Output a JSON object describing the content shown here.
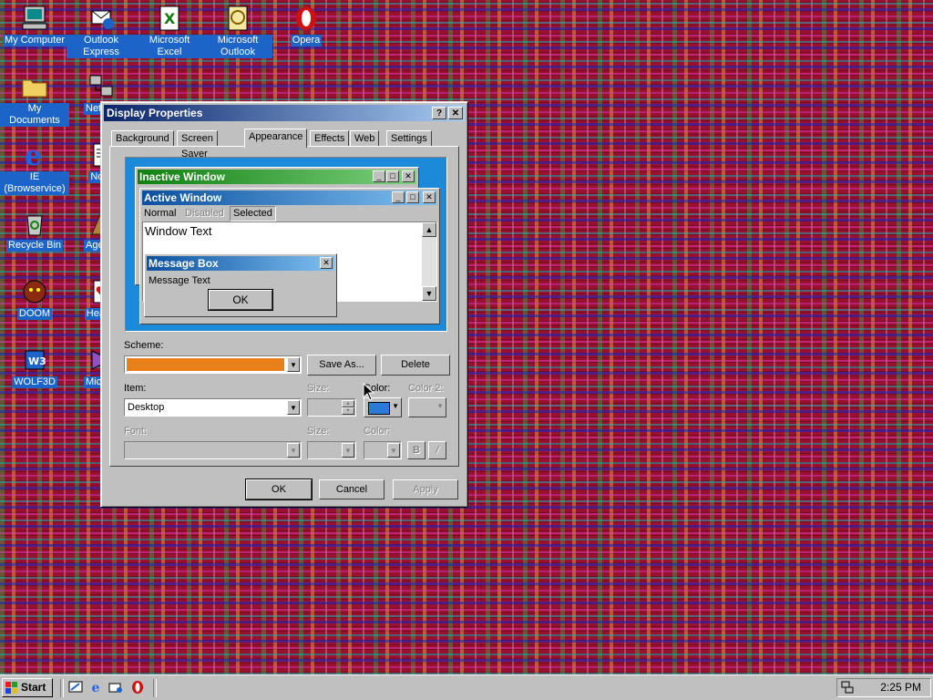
{
  "desktop": {
    "icons": [
      {
        "label": "My Computer",
        "icon": "my-computer-icon"
      },
      {
        "label": "Outlook Express",
        "icon": "outlook-express-icon"
      },
      {
        "label": "Microsoft Excel",
        "icon": "excel-icon"
      },
      {
        "label": "Microsoft Outlook",
        "icon": "outlook-icon"
      },
      {
        "label": "Opera",
        "icon": "opera-icon"
      },
      {
        "label": "My Documents",
        "icon": "folder-icon"
      },
      {
        "label": "Netw Neigh",
        "icon": "network-icon"
      },
      {
        "label": "IE (Browservice)",
        "icon": "ie-icon"
      },
      {
        "label": "Note",
        "icon": "notepad-icon"
      },
      {
        "label": "Recycle Bin",
        "icon": "recycle-bin-icon"
      },
      {
        "label": "Age Emp",
        "icon": "age-of-empires-icon"
      },
      {
        "label": "DOOM",
        "icon": "doom-icon"
      },
      {
        "label": "Hearts",
        "icon": "hearts-icon"
      },
      {
        "label": "WOLF3D",
        "icon": "wolf3d-icon"
      },
      {
        "label": "Micr Visual",
        "icon": "visual-studio-icon"
      }
    ]
  },
  "dialog": {
    "title": "Display Properties",
    "help_btn": "?",
    "close_btn": "✕",
    "tabs": [
      "Background",
      "Screen Saver",
      "Appearance",
      "Effects",
      "Web",
      "Settings"
    ],
    "selected_tab": "Appearance",
    "preview": {
      "inactive_title": "Inactive Window",
      "active_title": "Active Window",
      "menu": {
        "normal": "Normal",
        "disabled": "Disabled",
        "selected": "Selected"
      },
      "window_text": "Window Text",
      "msgbox_title": "Message Box",
      "msgbox_text": "Message Text",
      "ok": "OK"
    },
    "scheme_label": "Scheme:",
    "scheme_value": "",
    "scheme_color": "#e8801a",
    "save_as": "Save As...",
    "delete": "Delete",
    "item_label": "Item:",
    "item_value": "Desktop",
    "size_label": "Size:",
    "color_label": "Color:",
    "color2_label": "Color 2:",
    "item_color": "#2a7ad8",
    "font_label": "Font:",
    "font_size_label": "Size:",
    "font_color_label": "Color:",
    "bold": "B",
    "italic": "/",
    "ok": "OK",
    "cancel": "Cancel",
    "apply": "Apply"
  },
  "taskbar": {
    "start": "Start",
    "quick_launch": [
      "show-desktop-icon",
      "ie-icon",
      "outlook-express-icon",
      "opera-icon"
    ],
    "clock": "2:25 PM"
  }
}
